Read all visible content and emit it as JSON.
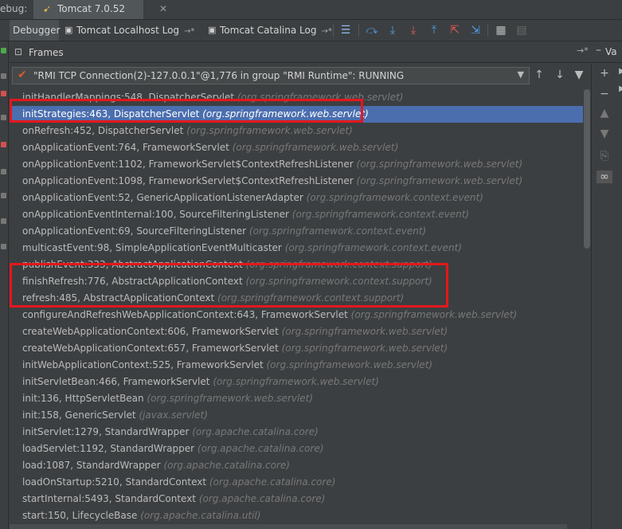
{
  "titlebar": {
    "debug_label": "ebug:",
    "session_tab": "Tomcat 7.0.52"
  },
  "tabs": [
    {
      "label": "Debugger"
    },
    {
      "label": "Tomcat Localhost Log",
      "pin": "→*"
    },
    {
      "label": "Tomcat Catalina Log",
      "pin": "→*"
    }
  ],
  "frames_panel": {
    "title": "Frames",
    "pin": "→*",
    "variables_tab": "Va"
  },
  "thread": {
    "text": "\"RMI TCP Connection(2)-127.0.0.1\"@1,776 in group \"RMI Runtime\": RUNNING"
  },
  "frames": [
    {
      "method": "initHandlerMappings:548, DispatcherServlet",
      "pkg": "(org.springframework.web.servlet)"
    },
    {
      "method": "initStrategies:463, DispatcherServlet",
      "pkg": "(org.springframework.web.servlet)"
    },
    {
      "method": "onRefresh:452, DispatcherServlet",
      "pkg": "(org.springframework.web.servlet)"
    },
    {
      "method": "onApplicationEvent:764, FrameworkServlet",
      "pkg": "(org.springframework.web.servlet)"
    },
    {
      "method": "onApplicationEvent:1102, FrameworkServlet$ContextRefreshListener",
      "pkg": "(org.springframework.web.servlet)"
    },
    {
      "method": "onApplicationEvent:1098, FrameworkServlet$ContextRefreshListener",
      "pkg": "(org.springframework.web.servlet)"
    },
    {
      "method": "onApplicationEvent:52, GenericApplicationListenerAdapter",
      "pkg": "(org.springframework.context.event)"
    },
    {
      "method": "onApplicationEventInternal:100, SourceFilteringListener",
      "pkg": "(org.springframework.context.event)"
    },
    {
      "method": "onApplicationEvent:69, SourceFilteringListener",
      "pkg": "(org.springframework.context.event)"
    },
    {
      "method": "multicastEvent:98, SimpleApplicationEventMulticaster",
      "pkg": "(org.springframework.context.event)"
    },
    {
      "method": "publishEvent:333, AbstractApplicationContext",
      "pkg": "(org.springframework.context.support)"
    },
    {
      "method": "finishRefresh:776, AbstractApplicationContext",
      "pkg": "(org.springframework.context.support)"
    },
    {
      "method": "refresh:485, AbstractApplicationContext",
      "pkg": "(org.springframework.context.support)"
    },
    {
      "method": "configureAndRefreshWebApplicationContext:643, FrameworkServlet",
      "pkg": "(org.springframework.web.servlet)"
    },
    {
      "method": "createWebApplicationContext:606, FrameworkServlet",
      "pkg": "(org.springframework.web.servlet)"
    },
    {
      "method": "createWebApplicationContext:657, FrameworkServlet",
      "pkg": "(org.springframework.web.servlet)"
    },
    {
      "method": "initWebApplicationContext:525, FrameworkServlet",
      "pkg": "(org.springframework.web.servlet)"
    },
    {
      "method": "initServletBean:466, FrameworkServlet",
      "pkg": "(org.springframework.web.servlet)"
    },
    {
      "method": "init:136, HttpServletBean",
      "pkg": "(org.springframework.web.servlet)"
    },
    {
      "method": "init:158, GenericServlet",
      "pkg": "(javax.servlet)"
    },
    {
      "method": "initServlet:1279, StandardWrapper",
      "pkg": "(org.apache.catalina.core)"
    },
    {
      "method": "loadServlet:1192, StandardWrapper",
      "pkg": "(org.apache.catalina.core)"
    },
    {
      "method": "load:1087, StandardWrapper",
      "pkg": "(org.apache.catalina.core)"
    },
    {
      "method": "loadOnStartup:5210, StandardContext",
      "pkg": "(org.apache.catalina.core)"
    },
    {
      "method": "startInternal:5493, StandardContext",
      "pkg": "(org.apache.catalina.core)"
    },
    {
      "method": "start:150, LifecycleBase",
      "pkg": "(org.apache.catalina.util)"
    }
  ],
  "selected_frame_index": 1,
  "colors": {
    "selection": "#4b6eaf",
    "highlight_box": "#e4171c",
    "background": "#3c3f41"
  }
}
